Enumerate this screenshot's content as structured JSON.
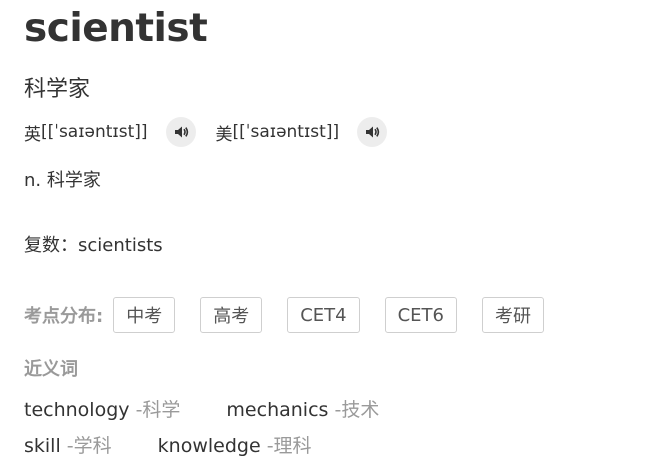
{
  "entry": {
    "word": "scientist",
    "translation": "科学家"
  },
  "pronunciation": {
    "uk_label": "英",
    "uk_phonetic": "[[ˈsaɪəntɪst]]",
    "us_label": "美",
    "us_phonetic": "[[ˈsaɪəntɪst]]"
  },
  "definition": "n. 科学家",
  "plural": "复数：scientists",
  "exam": {
    "label": "考点分布:",
    "tags": [
      "中考",
      "高考",
      "CET4",
      "CET6",
      "考研"
    ]
  },
  "synonyms": {
    "title": "近义词",
    "row1": [
      {
        "word": "technology",
        "def": "-科学"
      },
      {
        "word": "mechanics",
        "def": "-技术"
      }
    ],
    "row2": [
      {
        "word": "skill",
        "def": "-学科"
      },
      {
        "word": "knowledge",
        "def": "-理科"
      }
    ]
  },
  "icons": {
    "audio": "speaker-icon"
  },
  "colors": {
    "muted": "#9a9a9a",
    "text": "#333333",
    "icon_bg": "#ededed"
  }
}
